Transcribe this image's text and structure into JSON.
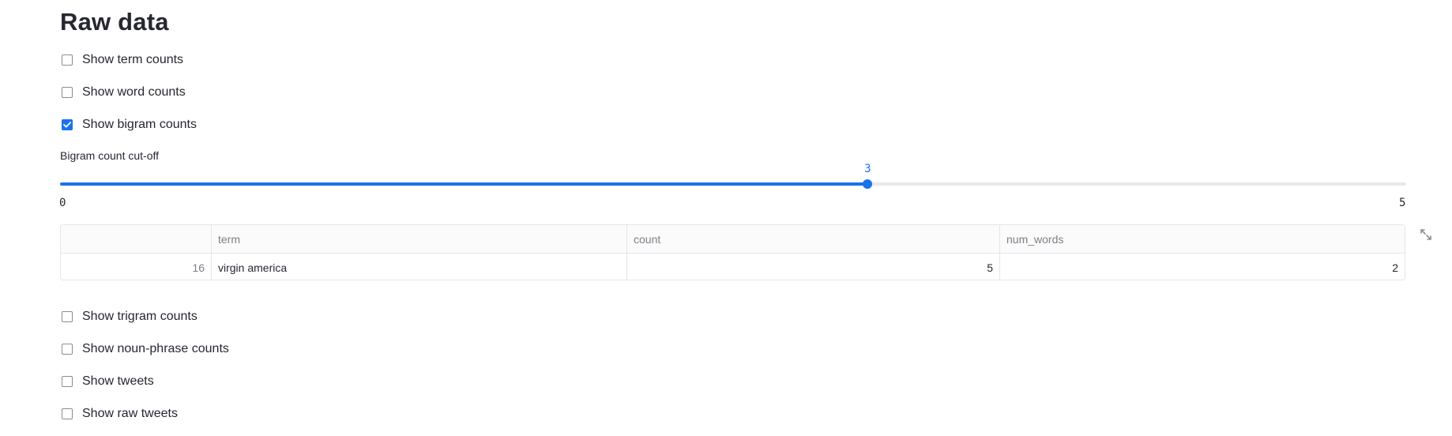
{
  "title": "Raw data",
  "checkboxes_top": [
    {
      "label": "Show term counts",
      "checked": false
    },
    {
      "label": "Show word counts",
      "checked": false
    },
    {
      "label": "Show bigram counts",
      "checked": true
    }
  ],
  "slider": {
    "label": "Bigram count cut-off",
    "min": "0",
    "max": "5",
    "value": "3",
    "fraction": 0.6
  },
  "table": {
    "columns": [
      "",
      "term",
      "count",
      "num_words"
    ],
    "rows": [
      {
        "index": "16",
        "term": "virgin america",
        "count": "5",
        "num_words": "2"
      }
    ]
  },
  "checkboxes_bottom": [
    {
      "label": "Show trigram counts",
      "checked": false
    },
    {
      "label": "Show noun-phrase counts",
      "checked": false
    },
    {
      "label": "Show tweets",
      "checked": false
    },
    {
      "label": "Show raw tweets",
      "checked": false
    }
  ],
  "icons": {
    "expand": "expand-arrows-icon",
    "check": "checkmark-icon"
  },
  "colors": {
    "accent": "#1a73e8",
    "text": "#262730",
    "muted": "#7d7f87"
  }
}
